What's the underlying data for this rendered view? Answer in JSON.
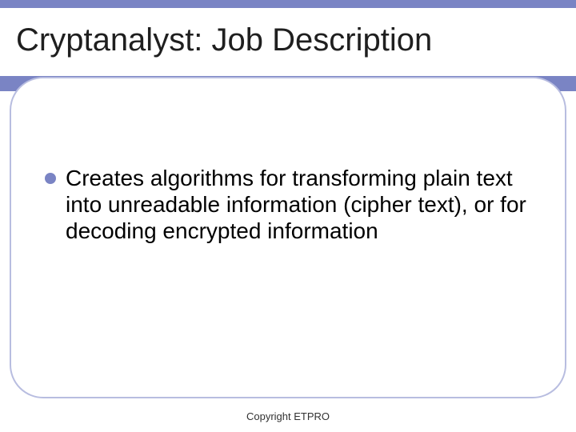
{
  "slide": {
    "title": "Cryptanalyst: Job Description",
    "bullets": [
      {
        "text": "Creates algorithms for transforming plain text into unreadable information (cipher text), or for decoding encrypted information"
      }
    ],
    "footer": "Copyright ETPRO"
  }
}
